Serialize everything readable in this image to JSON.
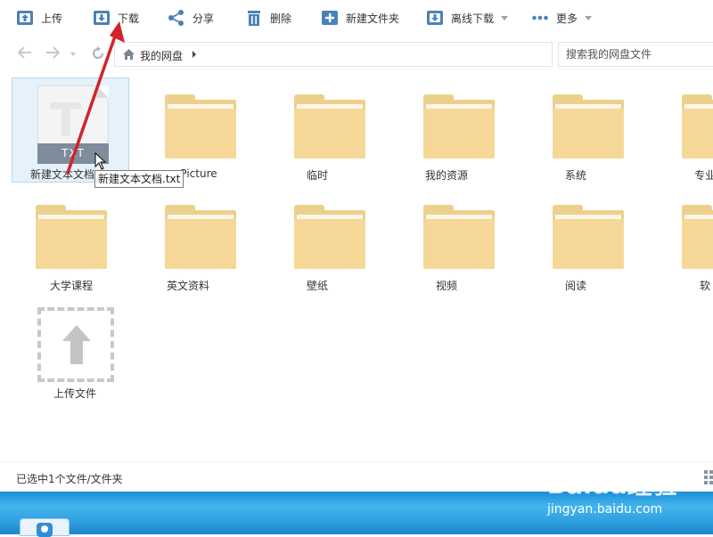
{
  "toolbar": {
    "items": [
      {
        "label": "上传",
        "icon": "upload-icon"
      },
      {
        "label": "下载",
        "icon": "download-icon"
      },
      {
        "label": "分享",
        "icon": "share-icon"
      },
      {
        "label": "删除",
        "icon": "trash-icon"
      },
      {
        "label": "新建文件夹",
        "icon": "new-folder-icon"
      },
      {
        "label": "离线下载",
        "icon": "offline-download-icon",
        "dropdown": true
      },
      {
        "label": "更多",
        "icon": "more-dots-icon",
        "dropdown": true
      }
    ]
  },
  "nav": {
    "breadcrumb": "我的网盘",
    "search_placeholder": "搜索我的网盘文件"
  },
  "files": [
    {
      "name": "新建文本文档",
      "type": "txt",
      "badge": "TXT",
      "selected": true
    },
    {
      "name": "Picture",
      "type": "folder"
    },
    {
      "name": "临时",
      "type": "folder"
    },
    {
      "name": "我的资源",
      "type": "folder"
    },
    {
      "name": "系统",
      "type": "folder"
    },
    {
      "name": "专业",
      "type": "folder"
    },
    {
      "name": "大学课程",
      "type": "folder"
    },
    {
      "name": "英文资料",
      "type": "folder"
    },
    {
      "name": "壁纸",
      "type": "folder"
    },
    {
      "name": "视频",
      "type": "folder"
    },
    {
      "name": "阅读",
      "type": "folder"
    },
    {
      "name": "软",
      "type": "folder"
    }
  ],
  "upload_tile": {
    "label": "上传文件"
  },
  "tooltip": "新建文本文档.txt",
  "status": "已选中1个文件/文件夹",
  "watermark": {
    "brand": "Baidu经验",
    "url": "jingyan.baidu.com"
  },
  "colors": {
    "annotation_arrow": "#d0242b",
    "folder": "#f5d898",
    "selection": "#e5f1fb"
  }
}
